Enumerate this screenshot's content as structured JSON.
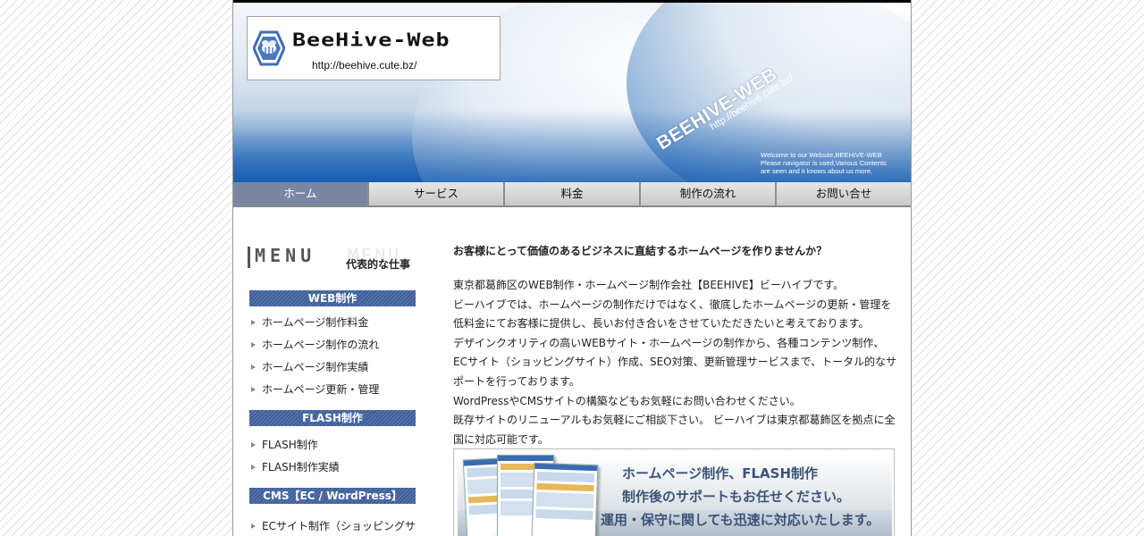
{
  "header": {
    "logo_name": "BeeHive-Web",
    "logo_url": "http://beehive.cute.bz/",
    "tilt_title": "BEEHIVE-WEB",
    "tilt_url": "http://beehive.cute.bz/",
    "welcome_lines": [
      "Welcome to our Website,BEEHIVE-WEB",
      "Please navigator is used,Various Contents",
      "are seen and it knows about us more."
    ]
  },
  "nav": {
    "items": [
      "ホーム",
      "サービス",
      "料金",
      "制作の流れ",
      "お問い合せ"
    ],
    "active_index": 0
  },
  "sidebar": {
    "menu_word": "MENU",
    "menu_ghost": "MENU",
    "menu_sub": "代表的な仕事",
    "sections": [
      {
        "title": "WEB制作",
        "items": [
          "ホームページ制作料金",
          "ホームページ制作の流れ",
          "ホームページ制作実績",
          "ホームページ更新・管理"
        ]
      },
      {
        "title": "FLASH制作",
        "items": [
          "FLASH制作",
          "FLASH制作実績"
        ]
      },
      {
        "title": "CMS【EC / WordPress】",
        "items": [
          "ECサイト制作（ショッピングサ"
        ]
      }
    ]
  },
  "main": {
    "lead": "お客様にとって価値のあるビジネスに直結するホームページを作りませんか？",
    "paragraph_lines": [
      "東京都葛飾区のWEB制作・ホームページ制作会社【BEEHIVE】ビーハイブです。",
      "ビーハイブでは、ホームページの制作だけではなく、徹底したホームページの更新・管理を",
      "低料金にてお客様に提供し、長いお付き合いをさせていただきたいと考えております。",
      "デザインクオリティの高いWEBサイト・ホームページの制作から、各種コンテンツ制作、",
      "ECサイト（ショッピングサイト）作成、SEO対策、更新管理サービスまで、トータル的なサ",
      "ポートを行っております。",
      "WordPressやCMSサイトの構築などもお気軽にお問い合わせください。",
      "既存サイトのリニューアルもお気軽にご相談下さい。 ビーハイブは東京都葛飾区を拠点に全",
      "国に対応可能です。"
    ],
    "banner_lines": [
      "ホームページ制作、FLASH制作",
      "制作後のサポートもお任せください。",
      "運用・保守に関しても迅速に対応いたします。"
    ]
  },
  "colors": {
    "nav_active": "#7a86a4",
    "section_head": "#3d5e9a",
    "header_blue": "#2f78c4"
  }
}
